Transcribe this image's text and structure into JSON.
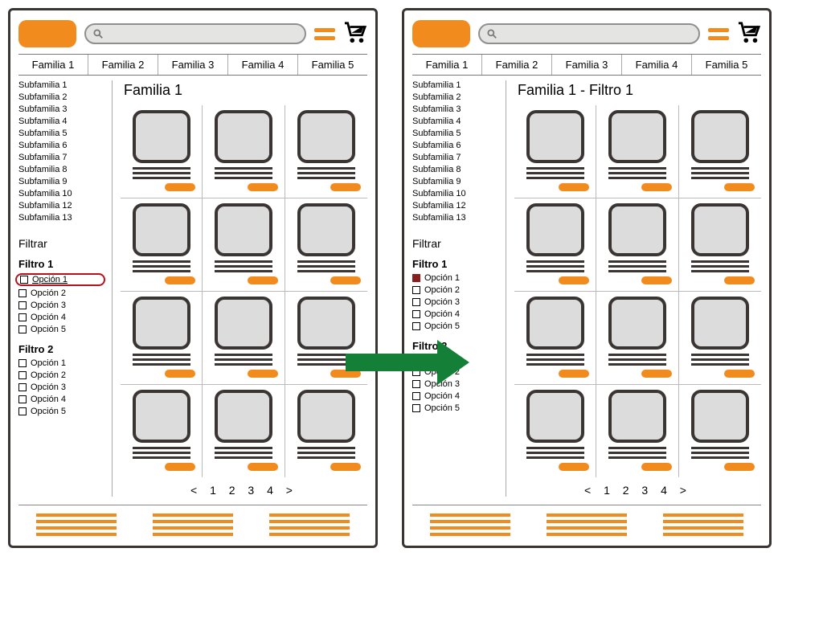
{
  "nav": [
    "Familia 1",
    "Familia 2",
    "Familia 3",
    "Familia 4",
    "Familia 5"
  ],
  "subfamilias": [
    "Subfamilia 1",
    "Subfamilia 2",
    "Subfamilia 3",
    "Subfamilia 4",
    "Subfamilia 5",
    "Subfamilia 6",
    "Subfamilia 7",
    "Subfamilia 8",
    "Subfamilia 9",
    "Subfamilia 10",
    "Subfamilia 12",
    "Subfamilia 13"
  ],
  "filtrar_label": "Filtrar",
  "filtro1": {
    "title": "Filtro 1",
    "opts": [
      "Opción 1",
      "Opción 2",
      "Opción 3",
      "Opción 4",
      "Opción 5"
    ]
  },
  "filtro2": {
    "title": "Filtro 2",
    "opts": [
      "Opción 1",
      "Opción 2",
      "Opción 3",
      "Opción 4",
      "Opción 5"
    ]
  },
  "left_title": "Familia 1",
  "right_title": "Familia 1 - Filtro 1",
  "pager": "<  1   2   3   4  >",
  "product_count": 12
}
